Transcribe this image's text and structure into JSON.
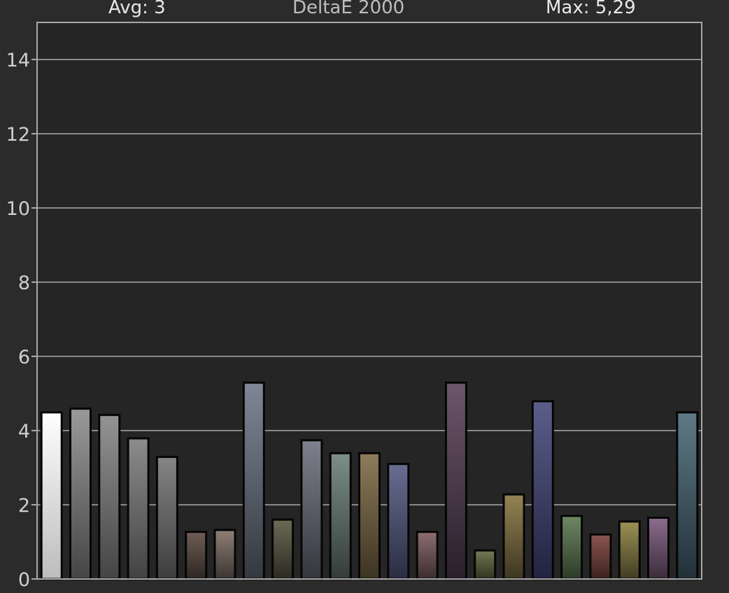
{
  "header": {
    "avg": "Avg: 3",
    "title": "DeltaE 2000",
    "max": "Max: 5,29"
  },
  "chart_data": {
    "type": "bar",
    "title": "DeltaE 2000",
    "xlabel": "",
    "ylabel": "",
    "ylim": [
      0,
      15
    ],
    "yticks": [
      "0",
      "2",
      "4",
      "6",
      "8",
      "10",
      "12",
      "14"
    ],
    "grid": true,
    "legend": "none",
    "categories": [],
    "values": [
      4.49,
      4.59,
      4.42,
      3.79,
      3.29,
      1.27,
      1.32,
      5.29,
      1.6,
      3.74,
      3.39,
      3.39,
      3.1,
      1.27,
      5.29,
      0.77,
      2.28,
      4.79,
      1.7,
      1.2,
      1.55,
      1.65,
      4.49
    ],
    "colors": [
      [
        "#ffffff",
        "#bcbcbc"
      ],
      [
        "#9a9a9a",
        "#454545"
      ],
      [
        "#949494",
        "#444444"
      ],
      [
        "#8c8c8c",
        "#424242"
      ],
      [
        "#858585",
        "#3d3d3d"
      ],
      [
        "#6e5e55",
        "#2e2622"
      ],
      [
        "#8e8076",
        "#3c3531"
      ],
      [
        "#7f8796",
        "#343840"
      ],
      [
        "#6c6a55",
        "#2b2a22"
      ],
      [
        "#80808e",
        "#35353d"
      ],
      [
        "#7c8f88",
        "#343c39"
      ],
      [
        "#8e7c5a",
        "#3c3322"
      ],
      [
        "#686e92",
        "#2a2d41"
      ],
      [
        "#8c6e70",
        "#3b2d2f"
      ],
      [
        "#6c566c",
        "#2a1f2a"
      ],
      [
        "#737a53",
        "#2f331f"
      ],
      [
        "#958454",
        "#3e3621"
      ],
      [
        "#5c5e8a",
        "#222340"
      ],
      [
        "#6f8863",
        "#2d3a28"
      ],
      [
        "#8c5550",
        "#3b2220"
      ],
      [
        "#9c9256",
        "#413c22"
      ],
      [
        "#8c6c8e",
        "#3a2c3b"
      ],
      [
        "#5e7a86",
        "#223038"
      ]
    ]
  }
}
